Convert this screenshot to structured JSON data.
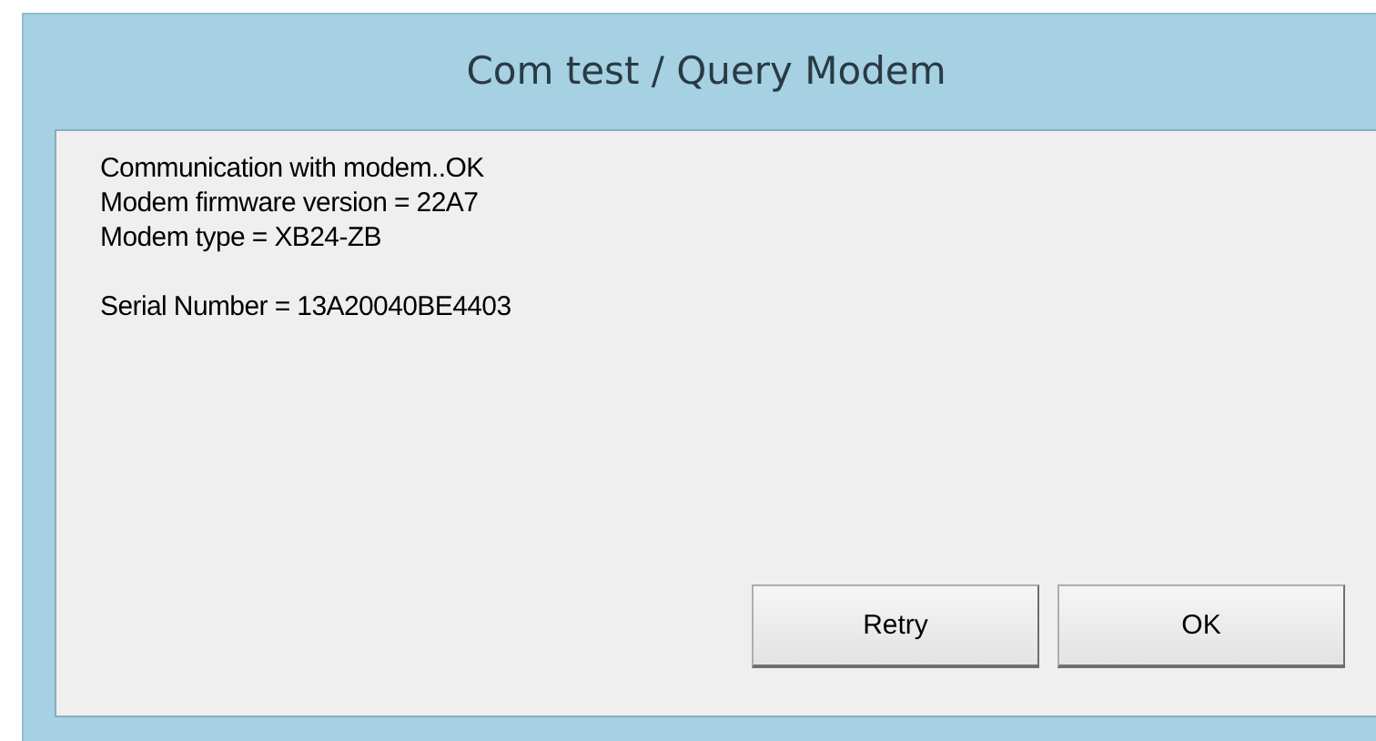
{
  "window": {
    "title": "Com test / Query Modem"
  },
  "message_groups": [
    [
      "Communication with modem..OK",
      "Modem firmware version = 22A7",
      "Modem type = XB24-ZB"
    ],
    [
      "Serial Number = 13A20040BE4403"
    ]
  ],
  "buttons": [
    {
      "label": "Retry"
    },
    {
      "label": "OK"
    }
  ]
}
